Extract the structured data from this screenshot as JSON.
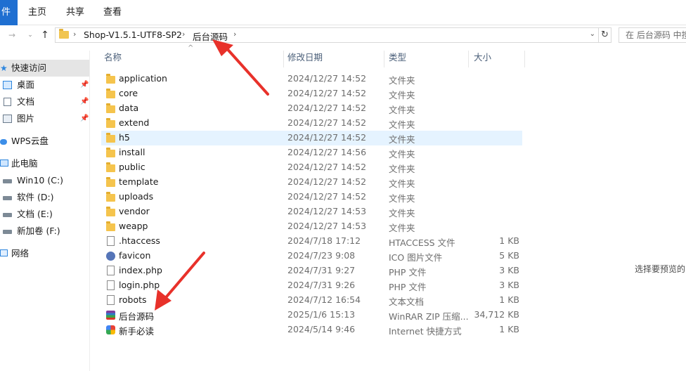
{
  "ribbon": {
    "tabs": [
      "件",
      "主页",
      "共享",
      "查看"
    ]
  },
  "address": {
    "crumbs": [
      "Shop-V1.5.1-UTF8-SP2",
      "后台源码"
    ],
    "search_placeholder": "在 后台源码 中搜"
  },
  "sidebar": {
    "items": [
      {
        "label": "快速访问",
        "icon": "star-icon"
      },
      {
        "label": "桌面",
        "icon": "desktop-icon",
        "pinned": true
      },
      {
        "label": "文档",
        "icon": "documents-icon",
        "pinned": true
      },
      {
        "label": "图片",
        "icon": "pictures-icon",
        "pinned": true
      },
      {
        "label": "WPS云盘",
        "icon": "cloud-icon"
      },
      {
        "label": "此电脑",
        "icon": "computer-icon"
      },
      {
        "label": "Win10 (C:)",
        "icon": "drive-icon"
      },
      {
        "label": "软件 (D:)",
        "icon": "drive-icon"
      },
      {
        "label": "文档 (E:)",
        "icon": "drive-icon"
      },
      {
        "label": "新加卷 (F:)",
        "icon": "drive-icon"
      },
      {
        "label": "网络",
        "icon": "network-icon"
      }
    ]
  },
  "columns": {
    "name": "名称",
    "date": "修改日期",
    "type": "类型",
    "size": "大小"
  },
  "files": [
    {
      "name": "application",
      "date": "2024/12/27 14:52",
      "type": "文件夹",
      "size": "",
      "icon": "folder"
    },
    {
      "name": "core",
      "date": "2024/12/27 14:52",
      "type": "文件夹",
      "size": "",
      "icon": "folder"
    },
    {
      "name": "data",
      "date": "2024/12/27 14:52",
      "type": "文件夹",
      "size": "",
      "icon": "folder"
    },
    {
      "name": "extend",
      "date": "2024/12/27 14:52",
      "type": "文件夹",
      "size": "",
      "icon": "folder"
    },
    {
      "name": "h5",
      "date": "2024/12/27 14:52",
      "type": "文件夹",
      "size": "",
      "icon": "folder",
      "selected": true
    },
    {
      "name": "install",
      "date": "2024/12/27 14:56",
      "type": "文件夹",
      "size": "",
      "icon": "folder"
    },
    {
      "name": "public",
      "date": "2024/12/27 14:52",
      "type": "文件夹",
      "size": "",
      "icon": "folder"
    },
    {
      "name": "template",
      "date": "2024/12/27 14:52",
      "type": "文件夹",
      "size": "",
      "icon": "folder"
    },
    {
      "name": "uploads",
      "date": "2024/12/27 14:52",
      "type": "文件夹",
      "size": "",
      "icon": "folder"
    },
    {
      "name": "vendor",
      "date": "2024/12/27 14:53",
      "type": "文件夹",
      "size": "",
      "icon": "folder"
    },
    {
      "name": "weapp",
      "date": "2024/12/27 14:53",
      "type": "文件夹",
      "size": "",
      "icon": "folder"
    },
    {
      "name": ".htaccess",
      "date": "2024/7/18 17:12",
      "type": "HTACCESS 文件",
      "size": "1 KB",
      "icon": "doc"
    },
    {
      "name": "favicon",
      "date": "2024/7/23 9:08",
      "type": "ICO 图片文件",
      "size": "5 KB",
      "icon": "ico"
    },
    {
      "name": "index.php",
      "date": "2024/7/31 9:27",
      "type": "PHP 文件",
      "size": "3 KB",
      "icon": "doc"
    },
    {
      "name": "login.php",
      "date": "2024/7/31 9:26",
      "type": "PHP 文件",
      "size": "3 KB",
      "icon": "doc"
    },
    {
      "name": "robots",
      "date": "2024/7/12 16:54",
      "type": "文本文档",
      "size": "1 KB",
      "icon": "doc"
    },
    {
      "name": "后台源码",
      "date": "2025/1/6 15:13",
      "type": "WinRAR ZIP 压缩...",
      "size": "34,712 KB",
      "icon": "rar"
    },
    {
      "name": "新手必读",
      "date": "2024/5/14 9:46",
      "type": "Internet 快捷方式",
      "size": "1 KB",
      "icon": "url"
    }
  ],
  "preview_text": "选择要预览的",
  "colors": {
    "selection": "#e5f3ff",
    "annotation_arrow": "#e8312a",
    "folder": "#f5c44d"
  }
}
